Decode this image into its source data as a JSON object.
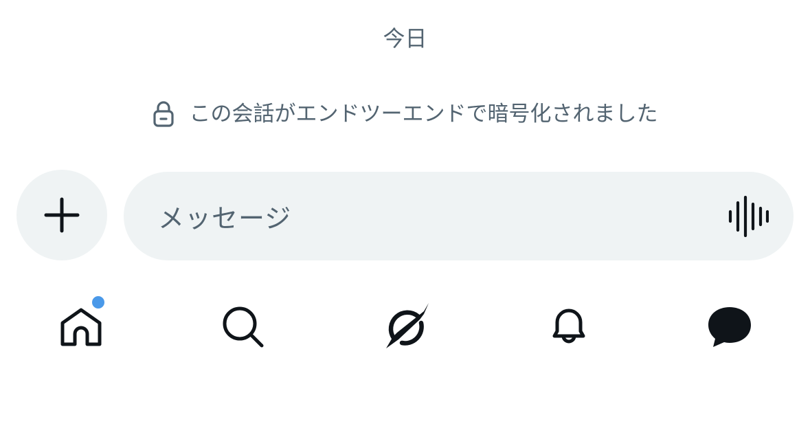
{
  "conversation": {
    "date_label": "今日",
    "encryption_notice": "この会話がエンドツーエンドで暗号化されました",
    "encryption_icon": "lock-icon"
  },
  "composer": {
    "attach_icon": "plus-icon",
    "placeholder": "メッセージ",
    "voice_icon": "voice-waveform-icon"
  },
  "tabbar": {
    "tabs": [
      {
        "name": "home",
        "icon": "home-icon",
        "has_notification_dot": true,
        "dot_color": "#4a99e9"
      },
      {
        "name": "search",
        "icon": "search-icon"
      },
      {
        "name": "grok",
        "icon": "grok-icon"
      },
      {
        "name": "notifications",
        "icon": "bell-icon"
      },
      {
        "name": "messages",
        "icon": "message-bubble-icon",
        "active": true
      }
    ]
  },
  "colors": {
    "secondary_text": "#536471",
    "input_background": "#eff3f4",
    "icon": "#0f1419",
    "notification_dot": "#4a99e9"
  }
}
